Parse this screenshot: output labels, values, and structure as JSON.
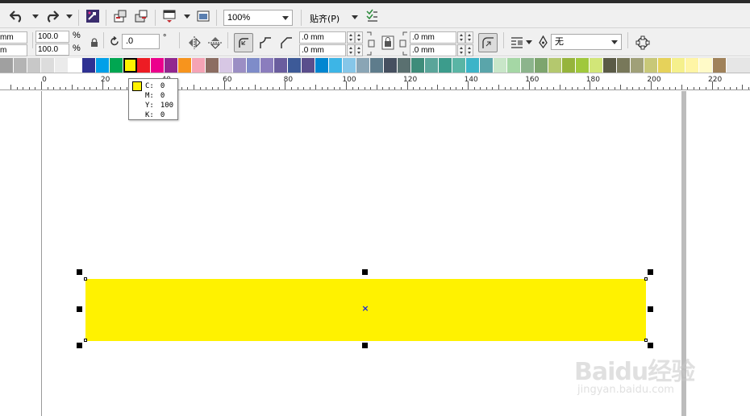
{
  "toolbar_top": {
    "zoom": {
      "value": "100%"
    },
    "snap": {
      "label": "贴齐(P)"
    },
    "icons": [
      "undo-icon",
      "redo-icon",
      "launcher-icon",
      "import-icon",
      "export-icon",
      "publish-pdf-icon",
      "application-icon",
      "options-icon"
    ]
  },
  "property_bar": {
    "left_x_value": "mm",
    "left_y_value": "m",
    "scale_x": "100.0",
    "scale_y": "100.0",
    "percent": "%",
    "rotation": ".0",
    "degree": "°",
    "corner_radius_1": ".0 mm",
    "corner_radius_2": ".0 mm",
    "corner_radius_3": ".0 mm",
    "corner_radius_4": ".0 mm",
    "outline_width": "无"
  },
  "palette": {
    "colors": [
      "#a0a0a0",
      "#b4b4b4",
      "#c8c8c8",
      "#dcdcdc",
      "#ebebeb",
      "#ffffff",
      "#2e3192",
      "#00a0e9",
      "#00a651",
      "#fff200",
      "#ed1c24",
      "#ec008c",
      "#92278f",
      "#f7941d",
      "#f5a3b5",
      "#8c6d62",
      "#d7c7e4",
      "#9b8ec4",
      "#7e8cc9",
      "#8b7dbd",
      "#6a5d9e",
      "#3d5a98",
      "#5a4e8c",
      "#0086d1",
      "#3db5e6",
      "#86c6e8",
      "#8aa5b5",
      "#5e7c8c",
      "#465060",
      "#5a7070",
      "#3e8c7a",
      "#5aa59a",
      "#3c9c8c",
      "#5ab5a5",
      "#3cb4c8",
      "#5aa5aa",
      "#c8e6c8",
      "#a5d7a5",
      "#8cb48c",
      "#7da56e",
      "#b4c86e",
      "#96b43c",
      "#a0c83c",
      "#d2e678",
      "#5a5a46",
      "#78785a",
      "#a0a078",
      "#c8c878",
      "#e6d25a",
      "#f5f08c",
      "#fff5a5",
      "#fffac8",
      "#a0825a"
    ],
    "selected_index": 9
  },
  "ruler": {
    "labels": [
      "0",
      "20",
      "40",
      "60",
      "80",
      "100",
      "120",
      "140",
      "160",
      "180",
      "200",
      "220"
    ]
  },
  "tooltip": {
    "c_label": "C:",
    "c_value": "0",
    "m_label": "M:",
    "m_value": "0",
    "y_label": "Y:",
    "y_value": "100",
    "k_label": "K:",
    "k_value": "0",
    "swatch_color": "#fff200"
  },
  "rectangle": {
    "fill": "#fff200"
  },
  "watermark": {
    "brand": "Baidu经验",
    "url": "jingyan.baidu.com"
  }
}
